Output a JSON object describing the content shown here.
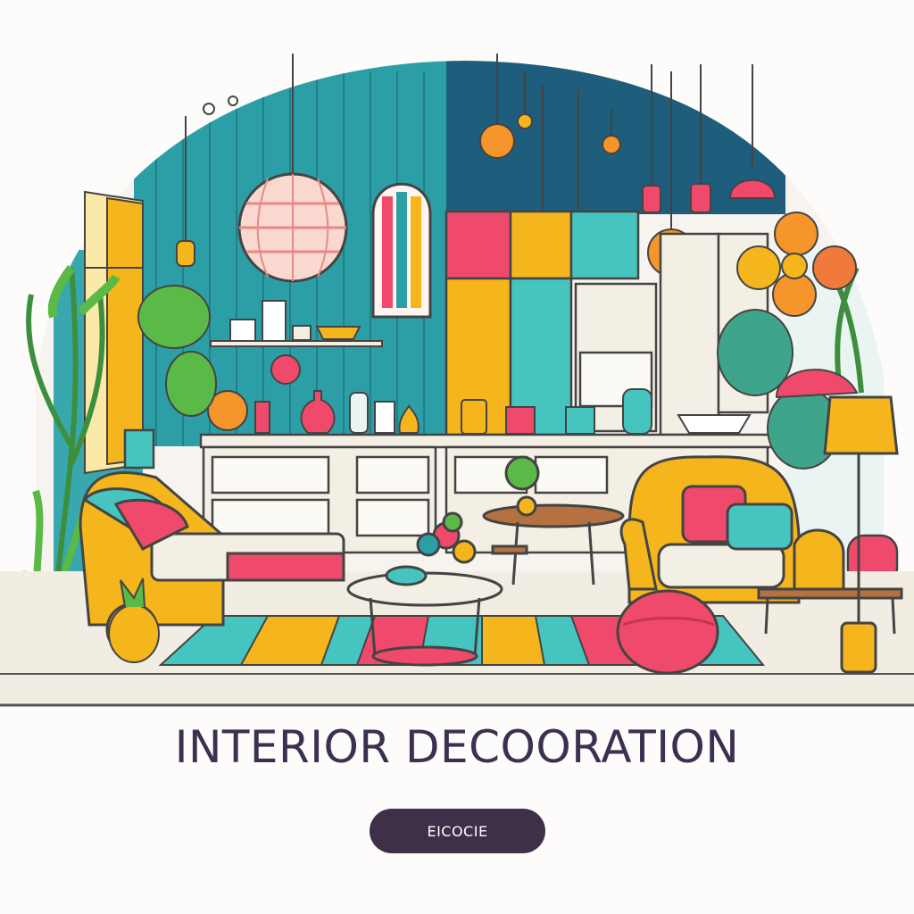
{
  "headline": "INTERIOR DECOORATION",
  "button": {
    "label": "EICOCIE"
  },
  "colors": {
    "text": "#3a3150",
    "button_bg": "#3d3048",
    "button_text": "#ffffff",
    "teal_wall": "#2c9fa6",
    "navy_wall": "#1f5d7c",
    "cabinet": "#f3efe4",
    "yellow": "#f5b51c",
    "pink": "#ef4a6b",
    "green": "#5bb947",
    "floor": "#f2ede2",
    "wood": "#b5713f"
  },
  "illustration": {
    "icons": [
      "pendant-lamp-icon",
      "window-icon",
      "plant-icon",
      "sofa-icon",
      "armchair-icon",
      "coffee-table-icon",
      "rug-icon",
      "floor-lamp-icon",
      "flower-icon",
      "pouf-icon",
      "dining-table-icon",
      "kitchen-cabinets-icon"
    ]
  }
}
